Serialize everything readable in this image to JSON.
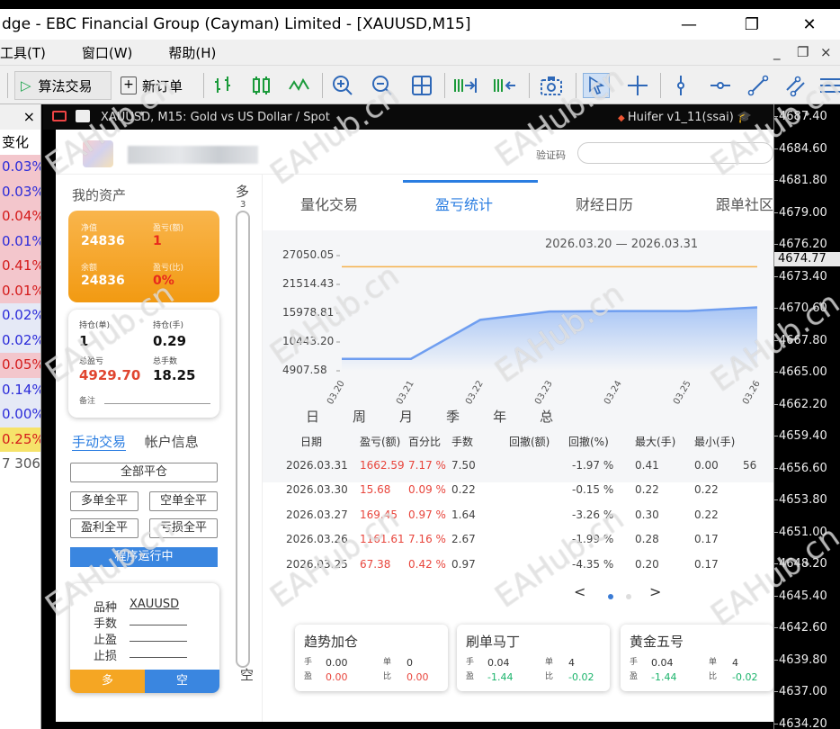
{
  "window": {
    "title": "dge - EBC Financial Group (Cayman) Limited - [XAUUSD,M15]",
    "minimize": "—",
    "restore": "❐",
    "close": "✕"
  },
  "menu": [
    "工具(T)",
    "窗口(W)",
    "帮助(H)"
  ],
  "mdi_controls": [
    "_",
    "❐",
    "×"
  ],
  "toolbar": {
    "algo_trading": "算法交易",
    "new_order": "新订单"
  },
  "market_watch": {
    "close": "×",
    "header": "变化",
    "rows": [
      {
        "v": "0.03%",
        "bg": "#f3c6cc",
        "c": "#2b2bd9"
      },
      {
        "v": "0.03%",
        "bg": "#f3c6cc",
        "c": "#2b2bd9"
      },
      {
        "v": "0.04%",
        "bg": "#f3c6cc",
        "c": "#d41a1a"
      },
      {
        "v": "0.01%",
        "bg": "#f3c6cc",
        "c": "#2b2bd9"
      },
      {
        "v": "0.41%",
        "bg": "#f3c6cc",
        "c": "#d41a1a"
      },
      {
        "v": "0.01%",
        "bg": "#f3c6cc",
        "c": "#d41a1a"
      },
      {
        "v": "0.02%",
        "bg": "#e5e9f6",
        "c": "#2b2bd9"
      },
      {
        "v": "0.02%",
        "bg": "#e5e9f6",
        "c": "#2b2bd9"
      },
      {
        "v": "0.05%",
        "bg": "#f3c6cc",
        "c": "#d41a1a"
      },
      {
        "v": "0.14%",
        "bg": "#e5e9f6",
        "c": "#2b2bd9"
      },
      {
        "v": "0.00%",
        "bg": "#e5e9f6",
        "c": "#2b2bd9"
      },
      {
        "v": "0.25%",
        "bg": "#f6e36a",
        "c": "#d41a1a"
      },
      {
        "v": "7 306",
        "bg": "#ffffff",
        "c": "#555555"
      }
    ]
  },
  "chart": {
    "title": "XAUUSD, M15:  Gold vs US Dollar / Spot",
    "ea_name": "Huifer v1_11(ssai)",
    "price_ticks": [
      "4687.40",
      "4684.60",
      "4681.80",
      "4679.00",
      "4676.20",
      "4673.40",
      "4670.60",
      "4667.80",
      "4665.00",
      "4662.20",
      "4659.40",
      "4656.60",
      "4653.80",
      "4651.00",
      "4648.20",
      "4645.40",
      "4642.60",
      "4639.80",
      "4637.00",
      "4634.20"
    ],
    "current_price": "4674.77"
  },
  "ea": {
    "verify_label": "验证码",
    "my_assets": "我的资产",
    "duo": "多",
    "duo_count": "3",
    "kong": "空",
    "orange_card": {
      "l1": "净值",
      "v1": "24836",
      "l2": "盈亏(额)",
      "v2": "1",
      "l3": "余额",
      "v3": "24836",
      "l4": "盈亏(比)",
      "v4": "0%"
    },
    "white_card": {
      "l1": "持仓(单)",
      "v1": "1",
      "l2": "持仓(手)",
      "v2": "0.29",
      "l3": "总盈亏",
      "v3": "4929.70",
      "l4": "总手数",
      "v4": "18.25",
      "note": "备注"
    },
    "tab_manual": "手动交易",
    "tab_account": "帐户信息",
    "btn_close_all": "全部平仓",
    "btn_close_long": "多单全平",
    "btn_close_short": "空单全平",
    "btn_close_profit": "盈利全平",
    "btn_close_loss": "亏损全平",
    "running": "程序运行中",
    "order": {
      "symbol_label": "品种",
      "symbol": "XAUUSD",
      "lots_label": "手数",
      "tp_label": "止盈",
      "sl_label": "止损",
      "buy": "多",
      "sell": "空"
    },
    "tabs": [
      "量化交易",
      "盈亏统计",
      "财经日历",
      "跟单社区"
    ],
    "range": "2026.03.20 — 2026.03.31",
    "periods": [
      "日",
      "周",
      "月",
      "季",
      "年",
      "总"
    ],
    "table_headers": [
      "日期",
      "盈亏(额)",
      "百分比",
      "手数",
      "回撤(额)",
      "回撤(%)",
      "最大(手)",
      "最小(手)"
    ],
    "rows": [
      {
        "date": "2026.03.31",
        "pl": "1662.59",
        "pct": "7.17 %",
        "lots": "7.50",
        "dd": "-1.97 %",
        "max": "0.41",
        "min": "0.00",
        "extra": "56"
      },
      {
        "date": "2026.03.30",
        "pl": "15.68",
        "pct": "0.09 %",
        "lots": "0.22",
        "dd": "-0.15 %",
        "max": "0.22",
        "min": "0.22",
        "extra": ""
      },
      {
        "date": "2026.03.27",
        "pl": "169.45",
        "pct": "0.97 %",
        "lots": "1.64",
        "dd": "-3.26 %",
        "max": "0.30",
        "min": "0.22",
        "extra": ""
      },
      {
        "date": "2026.03.26",
        "pl": "1161.61",
        "pct": "7.16 %",
        "lots": "2.67",
        "dd": "-1.99 %",
        "max": "0.28",
        "min": "0.17",
        "extra": ""
      },
      {
        "date": "2026.03.25",
        "pl": "67.38",
        "pct": "0.42 %",
        "lots": "0.97",
        "dd": "-4.35 %",
        "max": "0.20",
        "min": "0.17",
        "extra": ""
      }
    ],
    "pager_prev": "<",
    "pager_next": ">",
    "strategies": [
      {
        "name": "趋势加仓",
        "s1": "手",
        "v1": "0.00",
        "s2": "单",
        "v2": "0",
        "s3": "盈",
        "v3": "0.00",
        "s4": "比",
        "v4": "0.00"
      },
      {
        "name": "刷单马丁",
        "s1": "手",
        "v1": "0.04",
        "s2": "单",
        "v2": "4",
        "s3": "盈",
        "v3": "-1.44",
        "s4": "比",
        "v4": "-0.02"
      },
      {
        "name": "黄金五号",
        "s1": "手",
        "v1": "0.04",
        "s2": "单",
        "v2": "4",
        "s3": "盈",
        "v3": "-1.44",
        "s4": "比",
        "v4": "-0.02"
      }
    ]
  },
  "chart_data": {
    "type": "area",
    "x": [
      "03.20",
      "03.21",
      "03.22",
      "03.23",
      "03.24",
      "03.25",
      "03.26"
    ],
    "y_ticks": [
      "27050.05",
      "21514.43",
      "15978.81",
      "10443.20",
      "4907.58"
    ],
    "ylim": [
      4907.58,
      27050.05
    ],
    "series": [
      {
        "values": [
          7200,
          7200,
          14700,
          16300,
          16400,
          16400,
          17100
        ]
      },
      {
        "values": [
          24900,
          24900,
          24900,
          24900,
          24900,
          24900,
          24900
        ]
      }
    ],
    "colors": [
      "#6f9ef0",
      "#f5b14b"
    ]
  },
  "watermark": "EAHub.cn"
}
